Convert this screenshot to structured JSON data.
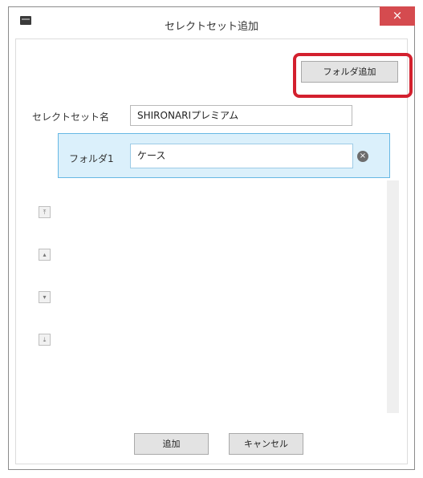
{
  "window": {
    "title": "セレクトセット追加",
    "close_label": "×"
  },
  "toolbar": {
    "add_folder_label": "フォルダ追加"
  },
  "form": {
    "set_name_label": "セレクトセット名",
    "set_name_value": "SHIRONARIプレミアム",
    "folder_label": "フォルダ1",
    "folder_value": "ケース",
    "remove_glyph": "×"
  },
  "side_buttons": [
    {
      "icon": "move-top-icon",
      "glyph": "⤒"
    },
    {
      "icon": "move-up-icon",
      "glyph": "▴"
    },
    {
      "icon": "move-down-icon",
      "glyph": "▾"
    },
    {
      "icon": "move-bottom-icon",
      "glyph": "⤓"
    }
  ],
  "footer": {
    "add_label": "追加",
    "cancel_label": "キャンセル"
  },
  "colors": {
    "close_button": "#d54b4f",
    "highlight_border": "#d3202e",
    "folder_row_bg": "#dbf0fb",
    "folder_row_border": "#67b8e4"
  }
}
